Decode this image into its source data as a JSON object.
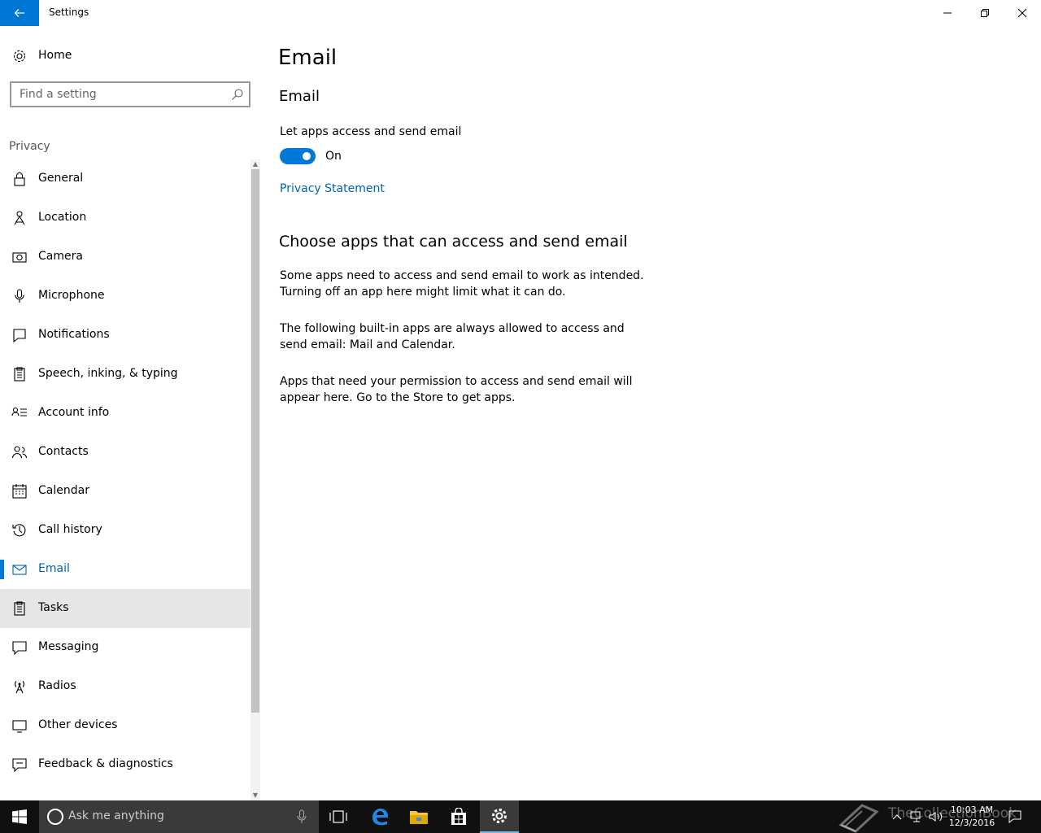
{
  "window": {
    "title": "Settings"
  },
  "sidebar": {
    "home_label": "Home",
    "search_placeholder": "Find a setting",
    "group_label": "Privacy",
    "items": [
      {
        "label": "General",
        "icon": "lock-icon"
      },
      {
        "label": "Location",
        "icon": "location-icon"
      },
      {
        "label": "Camera",
        "icon": "camera-icon"
      },
      {
        "label": "Microphone",
        "icon": "microphone-icon"
      },
      {
        "label": "Notifications",
        "icon": "notifications-icon"
      },
      {
        "label": "Speech, inking, & typing",
        "icon": "clipboard-icon"
      },
      {
        "label": "Account info",
        "icon": "account-info-icon"
      },
      {
        "label": "Contacts",
        "icon": "contacts-icon"
      },
      {
        "label": "Calendar",
        "icon": "calendar-icon"
      },
      {
        "label": "Call history",
        "icon": "history-icon"
      },
      {
        "label": "Email",
        "icon": "mail-icon",
        "selected": true
      },
      {
        "label": "Tasks",
        "icon": "tasks-icon",
        "hover": true
      },
      {
        "label": "Messaging",
        "icon": "message-icon"
      },
      {
        "label": "Radios",
        "icon": "radios-icon"
      },
      {
        "label": "Other devices",
        "icon": "devices-icon"
      },
      {
        "label": "Feedback & diagnostics",
        "icon": "feedback-icon"
      }
    ]
  },
  "main": {
    "page_title": "Email",
    "section_title": "Email",
    "toggle_label": "Let apps access and send email",
    "toggle_state": "On",
    "privacy_link": "Privacy Statement",
    "section2_title": "Choose apps that can access and send email",
    "paragraph1": "Some apps need to access and send email to work as intended. Turning off an app here might limit what it can do.",
    "paragraph2": "The following built-in apps are always allowed to access and send email: Mail and Calendar.",
    "paragraph3": "Apps that need your permission to access and send email will appear here. Go to the Store to get apps."
  },
  "taskbar": {
    "search_placeholder": "Ask me anything",
    "time": "10:03 AM",
    "date": "12/3/2016",
    "watermark": "TheCollectionBook"
  },
  "colors": {
    "accent": "#0078d7",
    "link": "#0063b1",
    "taskbar": "#101010"
  }
}
